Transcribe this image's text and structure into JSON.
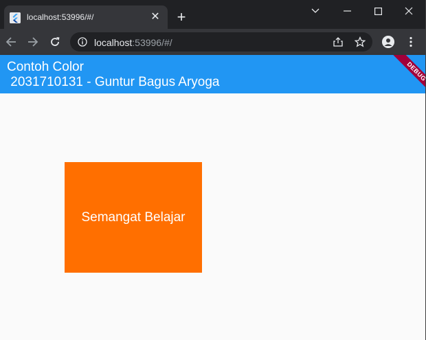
{
  "browser": {
    "tab": {
      "title": "localhost:53996/#/",
      "close_glyph": "✕",
      "favicon": "flutter-icon"
    },
    "new_tab_glyph": "+",
    "address": {
      "host": "localhost",
      "rest": ":53996/#/"
    },
    "colors": {
      "frame": "#202124",
      "toolbar": "#35363a",
      "omnibox": "#202124"
    }
  },
  "app": {
    "title": "Contoh Color\n 2031710131 - Guntur Bagus Aryoga",
    "debug_banner": "DEBUG",
    "box_label": "Semangat Belajar",
    "colors": {
      "appbar": "#2196f3",
      "box": "#ff6f00",
      "background": "#fafafa",
      "debug": "#a2003a"
    }
  }
}
